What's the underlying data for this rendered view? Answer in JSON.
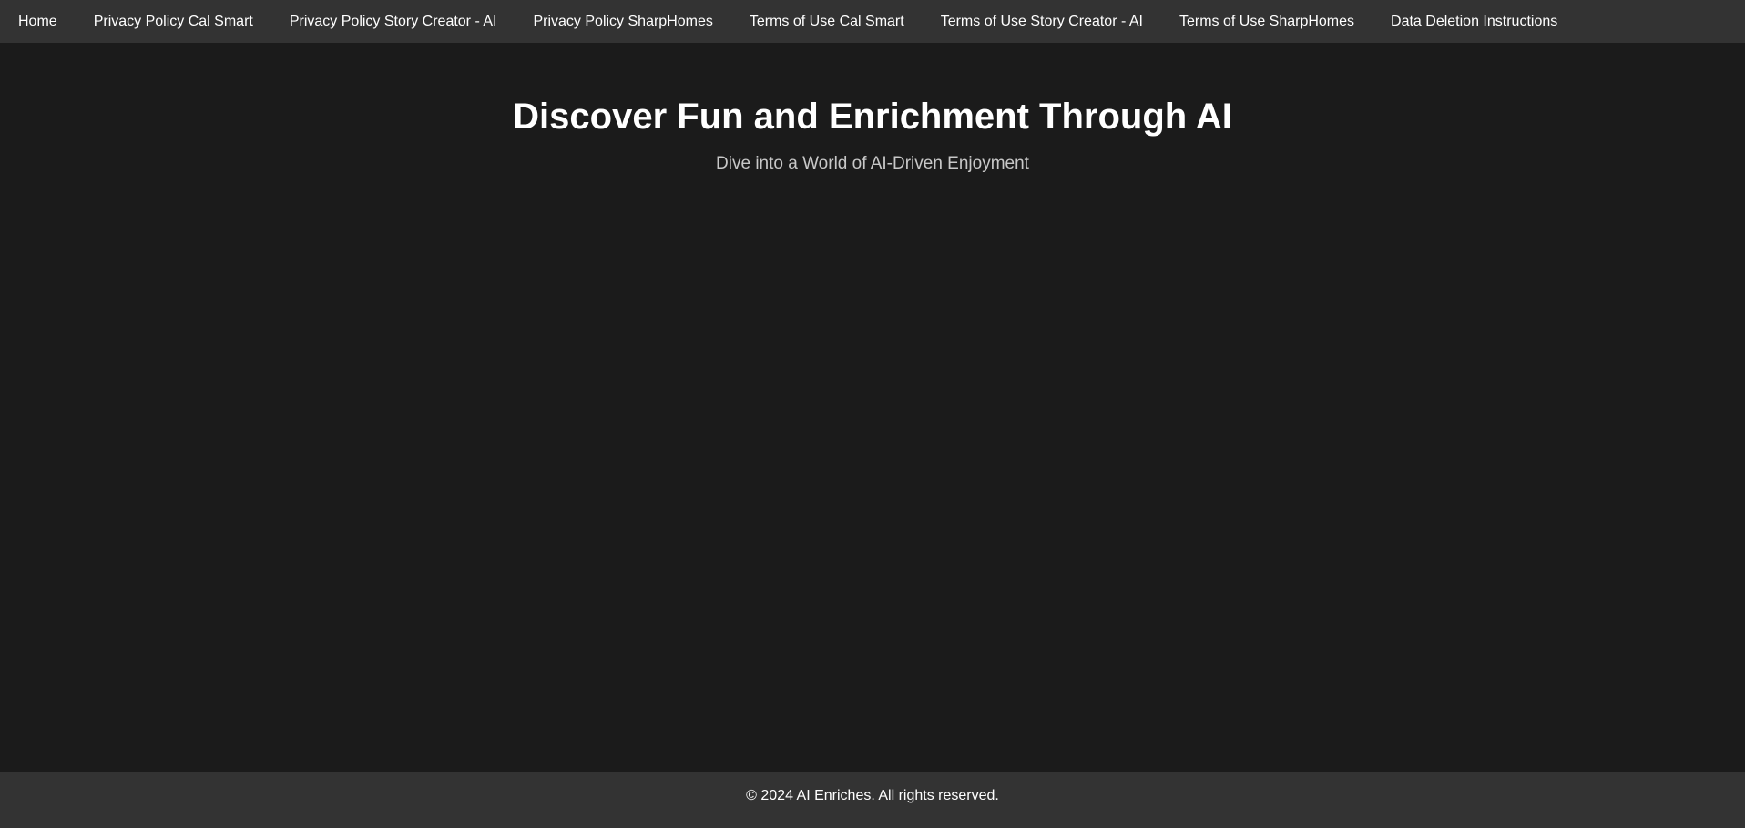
{
  "nav": {
    "items": [
      {
        "label": "Home"
      },
      {
        "label": "Privacy Policy Cal Smart"
      },
      {
        "label": "Privacy Policy Story Creator - AI"
      },
      {
        "label": "Privacy Policy SharpHomes"
      },
      {
        "label": "Terms of Use Cal Smart"
      },
      {
        "label": "Terms of Use Story Creator - AI"
      },
      {
        "label": "Terms of Use SharpHomes"
      },
      {
        "label": "Data Deletion Instructions"
      }
    ]
  },
  "hero": {
    "title": "Discover Fun and Enrichment Through AI",
    "subtitle": "Dive into a World of AI-Driven Enjoyment"
  },
  "footer": {
    "copyright": "© 2024 AI Enriches. All rights reserved."
  },
  "colors": {
    "background": "#1b1b1b",
    "bar": "#333333",
    "text": "#ffffff",
    "subtitle": "#c8c8c8"
  }
}
